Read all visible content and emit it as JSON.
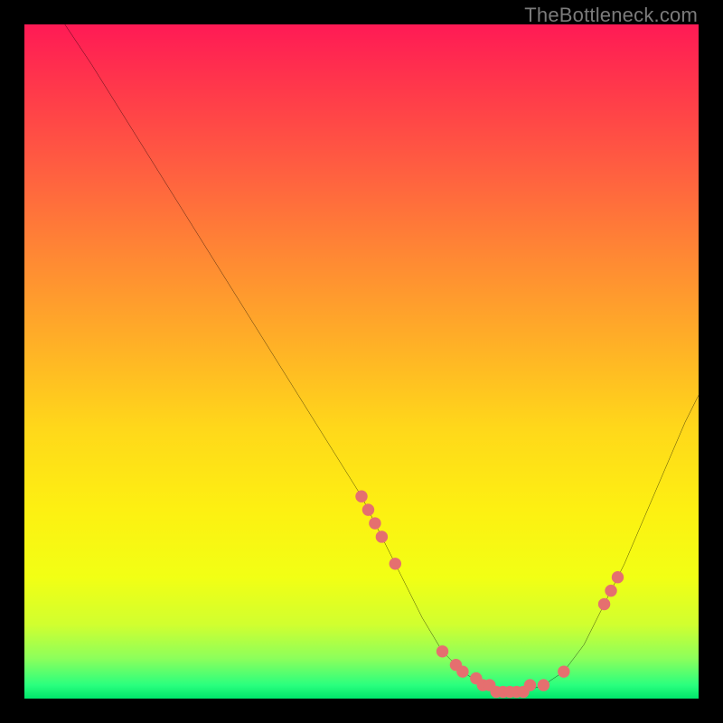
{
  "watermark": "TheBottleneck.com",
  "chart_data": {
    "type": "line",
    "title": "",
    "xlabel": "",
    "ylabel": "",
    "xlim": [
      0,
      100
    ],
    "ylim": [
      0,
      100
    ],
    "note": "Axes are implied (no tick labels shown). Values are approximate readings from the plotted curve on a 0–100 grid where (0,0) is bottom-left.",
    "series": [
      {
        "name": "bottleneck-curve",
        "x": [
          6,
          10,
          15,
          20,
          25,
          30,
          35,
          40,
          45,
          50,
          53,
          56,
          59,
          62,
          65,
          68,
          71,
          74,
          77,
          80,
          83,
          86,
          89,
          92,
          95,
          98,
          100
        ],
        "y": [
          100,
          94,
          86,
          78,
          70,
          62,
          54,
          46,
          38,
          30,
          24,
          18,
          12,
          7,
          4,
          2,
          1,
          1,
          2,
          4,
          8,
          14,
          20,
          27,
          34,
          41,
          45
        ]
      }
    ],
    "scatter": [
      {
        "name": "points-on-curve",
        "color": "#e56f6f",
        "x": [
          50,
          51,
          52,
          53,
          55,
          62,
          64,
          65,
          67,
          68,
          69,
          70,
          71,
          72,
          73,
          74,
          75,
          77,
          80,
          86,
          87,
          88
        ],
        "y": [
          30,
          28,
          26,
          24,
          20,
          7,
          5,
          4,
          3,
          2,
          2,
          1,
          1,
          1,
          1,
          1,
          2,
          2,
          4,
          14,
          16,
          18
        ]
      }
    ],
    "background_gradient": {
      "top": "#ff1a55",
      "mid": "#ffd81a",
      "bottom": "#00e56b"
    }
  }
}
